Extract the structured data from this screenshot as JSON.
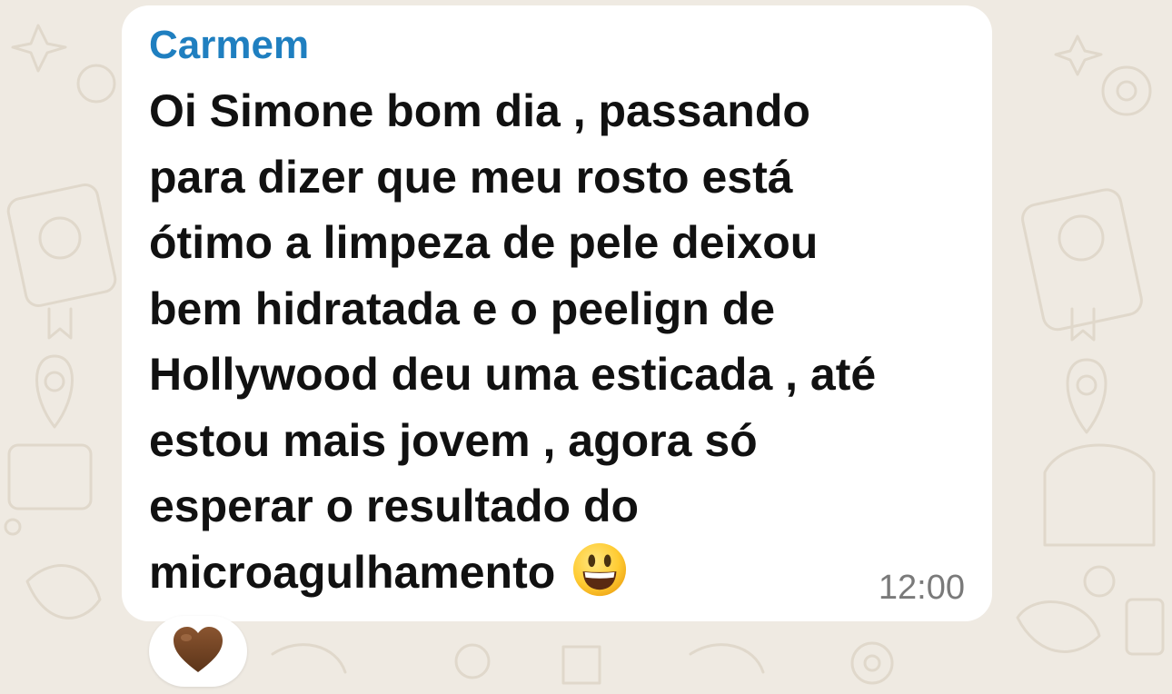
{
  "message": {
    "sender": "Carmem",
    "lines": [
      "Oi Simone bom dia , passando",
      "para dizer que meu rosto está",
      "ótimo a limpeza de pele deixou",
      "bem hidratada e o peelign de",
      "Hollywood deu uma esticada , até",
      "estou mais jovem , agora só",
      "esperar o resultado do",
      "microagulhamento"
    ],
    "inline_emoji": "grinning-face-big-eyes",
    "time": "12:00"
  },
  "reaction": {
    "emoji": "brown-heart"
  },
  "colors": {
    "background": "#efeae2",
    "bubble": "#ffffff",
    "sender_name": "#1f7fc0",
    "text": "#111111",
    "timestamp": "#7a7a7a",
    "heart": "#6b3e22"
  }
}
